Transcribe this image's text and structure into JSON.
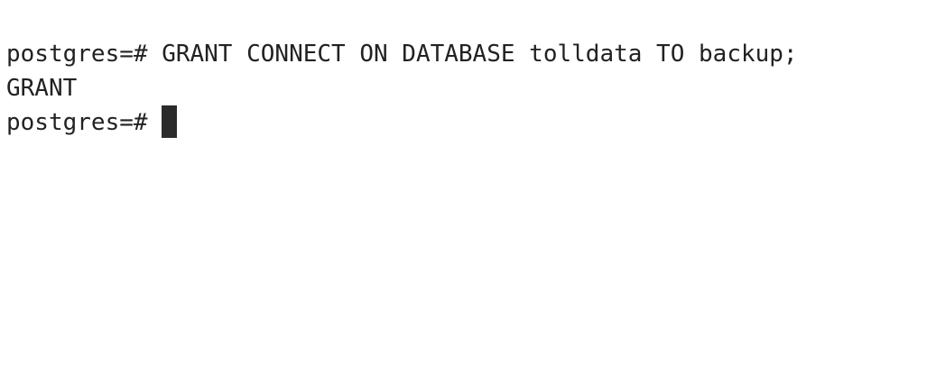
{
  "terminal": {
    "lines": [
      {
        "prompt": "postgres=# ",
        "command": "GRANT CONNECT ON DATABASE tolldata TO backup;"
      },
      {
        "output": "GRANT"
      },
      {
        "prompt": "postgres=# ",
        "command": ""
      }
    ],
    "colors": {
      "background": "#ffffff",
      "text": "#222222",
      "cursor": "#2b2b2b"
    }
  }
}
